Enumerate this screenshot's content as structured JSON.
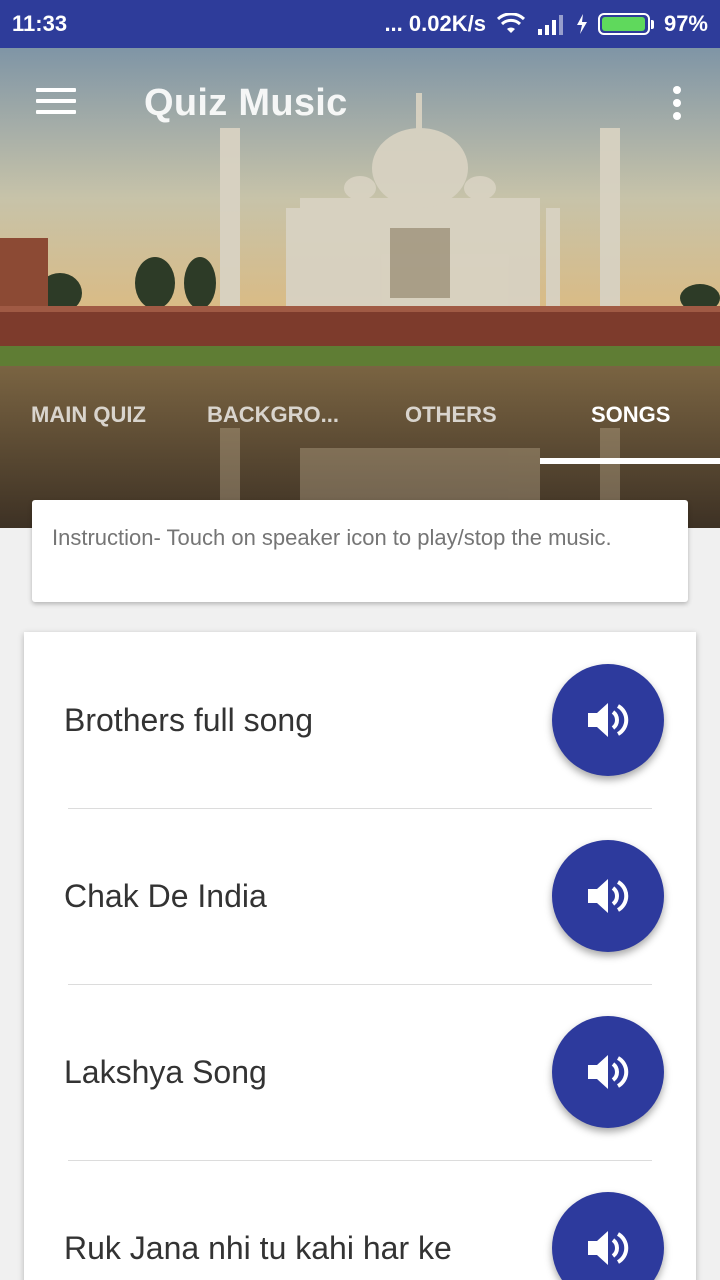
{
  "status_bar": {
    "time": "11:33",
    "network_speed": "... 0.02K/s",
    "battery_percent": "97%",
    "battery_level": 0.97
  },
  "app_bar": {
    "title": "Quiz Music",
    "menu_icon": "hamburger-menu-icon",
    "overflow_icon": "more-vert-icon"
  },
  "tabs": [
    {
      "label": "MAIN QUIZ"
    },
    {
      "label": "BACKGRO..."
    },
    {
      "label": "OTHERS"
    },
    {
      "label": "SONGS",
      "active": true
    }
  ],
  "instruction": "Instruction- Touch on speaker icon to play/stop the music.",
  "songs": [
    {
      "title": "Brothers full song"
    },
    {
      "title": "Chak De India"
    },
    {
      "title": "Lakshya Song"
    },
    {
      "title": "Ruk Jana nhi tu kahi har ke"
    }
  ],
  "colors": {
    "primary": "#2e3c9a",
    "play_button": "#2d3a9d",
    "battery_fill": "#5fd95c"
  }
}
